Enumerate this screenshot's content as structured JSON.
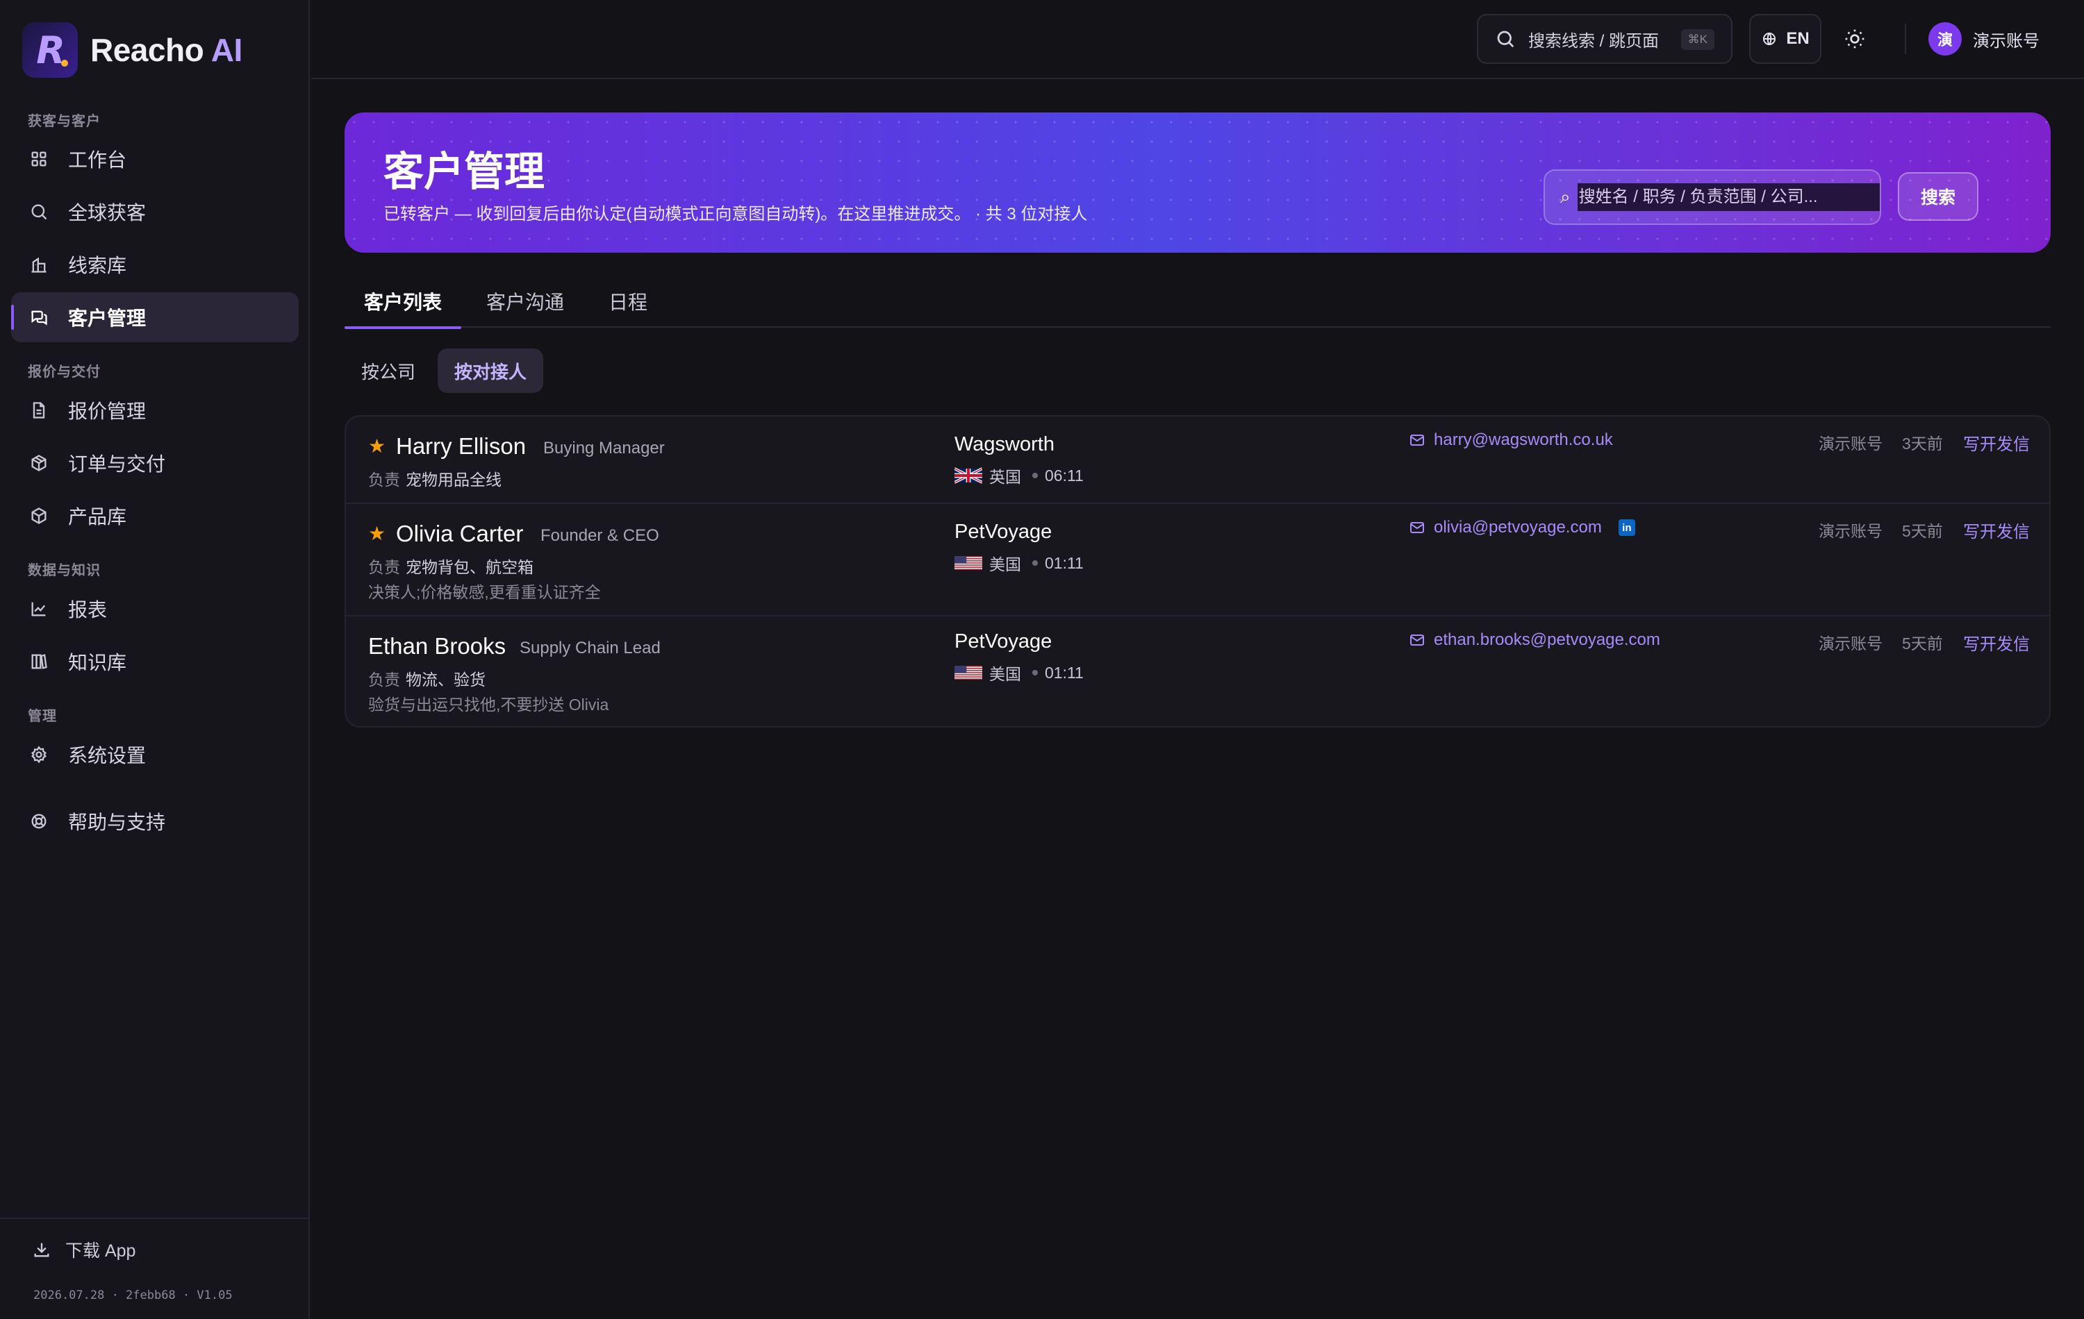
{
  "brand": {
    "logo_letter": "R",
    "name": "Reacho",
    "suffix": "AI"
  },
  "sidebar": {
    "sections": [
      {
        "label": "获客与客户"
      },
      {
        "label": "报价与交付"
      },
      {
        "label": "数据与知识"
      },
      {
        "label": "管理"
      }
    ],
    "items": [
      {
        "label": "工作台",
        "icon": "grid-icon"
      },
      {
        "label": "全球获客",
        "icon": "search-icon"
      },
      {
        "label": "线索库",
        "icon": "buildings-icon"
      },
      {
        "label": "客户管理",
        "icon": "chat-bubbles-icon",
        "active": true
      },
      {
        "label": "报价管理",
        "icon": "document-icon"
      },
      {
        "label": "订单与交付",
        "icon": "package-icon"
      },
      {
        "label": "产品库",
        "icon": "cube-icon"
      },
      {
        "label": "报表",
        "icon": "line-chart-icon"
      },
      {
        "label": "知识库",
        "icon": "books-icon"
      },
      {
        "label": "系统设置",
        "icon": "gear-icon"
      },
      {
        "label": "帮助与支持",
        "icon": "lifebuoy-icon"
      }
    ],
    "download_label": "下载 App",
    "version": "2026.07.28 · 2febb68 · V1.05"
  },
  "topbar": {
    "search_label": "搜索线索 / 跳页面",
    "search_shortcut": "⌘K",
    "lang": "EN",
    "avatar_text": "演",
    "account_name": "演示账号"
  },
  "hero": {
    "title": "客户管理",
    "subtitle": "已转客户 — 收到回复后由你认定(自动模式正向意图自动转)。在这里推进成交。 · 共 3 位对接人",
    "search_placeholder": "搜姓名 / 职务 / 负责范围 / 公司...",
    "search_button": "搜索"
  },
  "tabs": [
    {
      "label": "客户列表",
      "active": true
    },
    {
      "label": "客户沟通"
    },
    {
      "label": "日程"
    }
  ],
  "subtabs": [
    {
      "label": "按公司"
    },
    {
      "label": "按对接人",
      "active": true
    }
  ],
  "contacts": [
    {
      "starred": true,
      "name": "Harry Ellison",
      "title": "Buying Manager",
      "resp_label": "负责",
      "resp": "宠物用品全线",
      "note": "",
      "company": "Wagsworth",
      "country": "英国",
      "flag": "uk",
      "local_time": "06:11",
      "email": "harry@wagsworth.co.uk",
      "linkedin": false,
      "owner": "演示账号",
      "age": "3天前",
      "action": "写开发信"
    },
    {
      "starred": true,
      "name": "Olivia Carter",
      "title": "Founder & CEO",
      "resp_label": "负责",
      "resp": "宠物背包、航空箱",
      "note": "决策人;价格敏感,更看重认证齐全",
      "company": "PetVoyage",
      "country": "美国",
      "flag": "us",
      "local_time": "01:11",
      "email": "olivia@petvoyage.com",
      "linkedin": true,
      "linkedin_text": "in",
      "owner": "演示账号",
      "age": "5天前",
      "action": "写开发信"
    },
    {
      "starred": false,
      "name": "Ethan Brooks",
      "title": "Supply Chain Lead",
      "resp_label": "负责",
      "resp": "物流、验货",
      "note": "验货与出运只找他,不要抄送 Olivia",
      "company": "PetVoyage",
      "country": "美国",
      "flag": "us",
      "local_time": "01:11",
      "email": "ethan.brooks@petvoyage.com",
      "linkedin": false,
      "owner": "演示账号",
      "age": "5天前",
      "action": "写开发信"
    }
  ]
}
